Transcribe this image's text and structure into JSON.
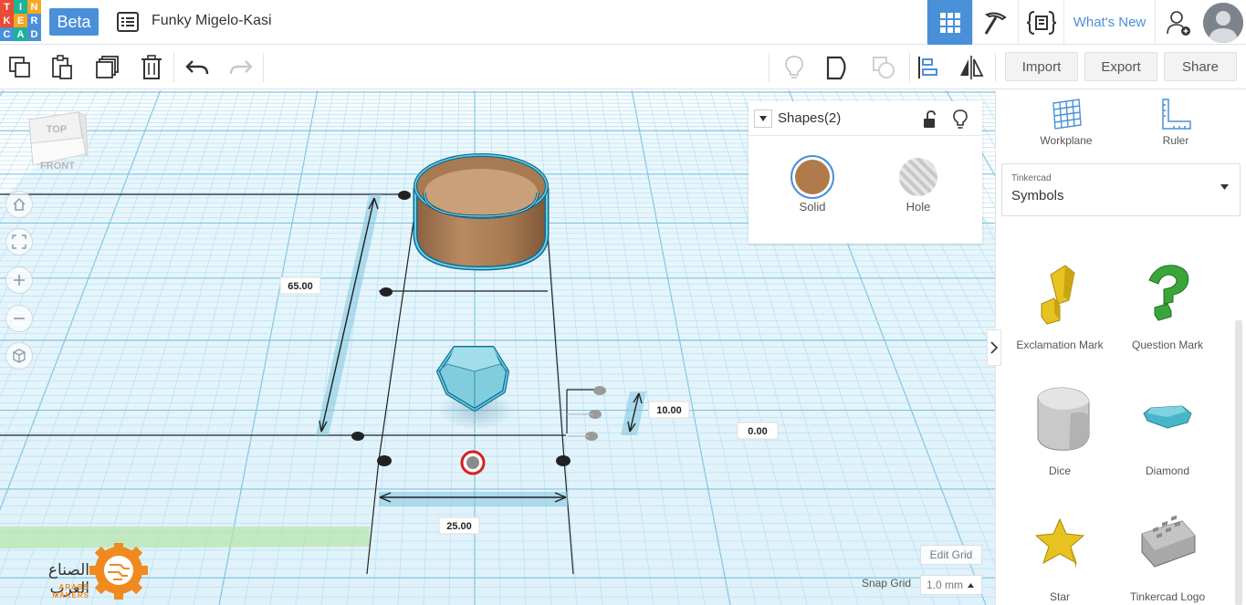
{
  "app": {
    "logo_letters": [
      "T",
      "I",
      "N",
      "K",
      "E",
      "R",
      "C",
      "A",
      "D"
    ],
    "logo_colors": [
      "#e94b35",
      "#1bb39a",
      "#f5a623",
      "#e94b35",
      "#f5a623",
      "#4a90d9",
      "#4a90d9",
      "#1bb39a",
      "#4a90d9"
    ],
    "beta_label": "Beta",
    "design_title": "Funky Migelo-Kasi",
    "whats_new_label": "What's New",
    "accent_color": "#4a90d9"
  },
  "toolbar": {
    "import_label": "Import",
    "export_label": "Export",
    "share_label": "Share"
  },
  "viewcube": {
    "top_label": "TOP",
    "front_label": "FRONT"
  },
  "shapes_panel": {
    "title": "Shapes(2)",
    "solid_label": "Solid",
    "hole_label": "Hole",
    "solid_color": "#b07a4a"
  },
  "dimensions": {
    "length": "65.00",
    "width": "25.00",
    "height": "10.00",
    "elevation": "0.00"
  },
  "grid": {
    "edit_grid_label": "Edit Grid",
    "snap_grid_label": "Snap Grid",
    "snap_value": "1.0 mm"
  },
  "watermark": {
    "arabic_text": "الصناع العرب",
    "english_text": "ARABS MAKERS"
  },
  "right_panel": {
    "workplane_label": "Workplane",
    "ruler_label": "Ruler",
    "library_source": "Tinkercad",
    "library_name": "Symbols",
    "shapes": [
      {
        "name": "Exclamation Mark",
        "icon": "exclamation-shape-icon",
        "color": "#e8c21e"
      },
      {
        "name": "Question Mark",
        "icon": "question-shape-icon",
        "color": "#3aa63a"
      },
      {
        "name": "Dice",
        "icon": "dice-shape-icon",
        "color": "#c9c9c9"
      },
      {
        "name": "Diamond",
        "icon": "diamond-shape-icon",
        "color": "#47b6c9"
      },
      {
        "name": "Star",
        "icon": "star-shape-icon",
        "color": "#e8c21e"
      },
      {
        "name": "Tinkercad Logo",
        "icon": "tinkercad-logo-shape-icon",
        "color": "#a8a8a8"
      }
    ]
  }
}
